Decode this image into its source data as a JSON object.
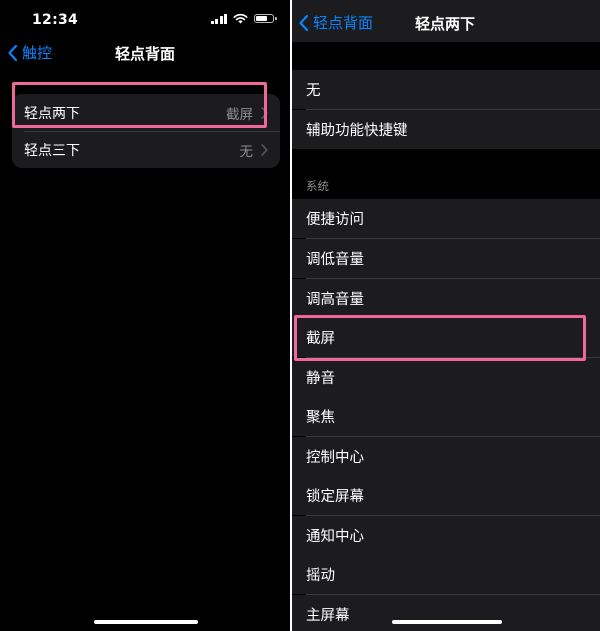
{
  "left": {
    "status": {
      "time": "12:34"
    },
    "nav": {
      "back_label": "触控",
      "title": "轻点背面"
    },
    "rows": [
      {
        "label": "轻点两下",
        "value": "截屏"
      },
      {
        "label": "轻点三下",
        "value": "无"
      }
    ]
  },
  "right": {
    "nav": {
      "back_label": "轻点背面",
      "title": "轻点两下"
    },
    "top_options": [
      "无",
      "辅助功能快捷键"
    ],
    "section_title": "系统",
    "system_options": [
      "便捷访问",
      "调低音量",
      "调高音量",
      "截屏",
      "静音",
      "聚焦",
      "控制中心",
      "锁定屏幕",
      "通知中心",
      "摇动",
      "主屏幕"
    ]
  },
  "colors": {
    "accent": "#0a84ff",
    "highlight": "#f0679a",
    "cell": "#1c1c1e",
    "background": "#000000"
  },
  "icons": [
    "signal-icon",
    "wifi-icon",
    "battery-icon",
    "chevron-left-icon",
    "chevron-right-icon"
  ]
}
